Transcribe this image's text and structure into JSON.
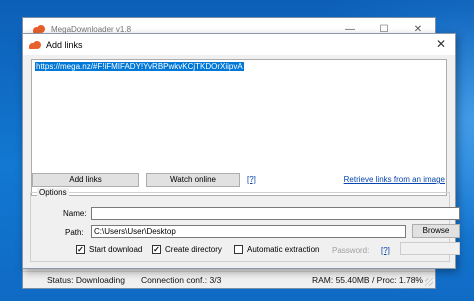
{
  "main_window": {
    "title": "MegaDownloader v1.8",
    "controls": {
      "minimize": "—",
      "maximize": "☐",
      "close": "✕"
    }
  },
  "dialog": {
    "title": "Add links",
    "close": "✕",
    "links_text": "https://mega.nz/#F!iFMIFADY!YvRBPwkvKCjTKDOrXiipvA",
    "add_links_button": "Add links",
    "watch_online_button": "Watch online",
    "help_link": "[?]",
    "retrieve_link": "Retrieve links from an image",
    "options": {
      "legend": "Options",
      "name_label": "Name:",
      "name_value": "",
      "path_label": "Path:",
      "path_value": "C:\\Users\\User\\Desktop",
      "browse_button": "Browse",
      "start_download_label": "Start download",
      "start_download_checked": true,
      "create_directory_label": "Create directory",
      "create_directory_checked": true,
      "automatic_extraction_label": "Automatic extraction",
      "automatic_extraction_checked": false,
      "password_label": "Password:",
      "password_help": "[?]",
      "password_value": ""
    }
  },
  "status_bar": {
    "status": "Status: Downloading",
    "connection": "Connection conf.: 3/3",
    "resources": "RAM: 55.40MB / Proc: 1.78%"
  },
  "colors": {
    "desktop": "#1278d2",
    "brand_logo": "#e8602c",
    "selection": "#0078d7",
    "link": "#0645ad"
  }
}
